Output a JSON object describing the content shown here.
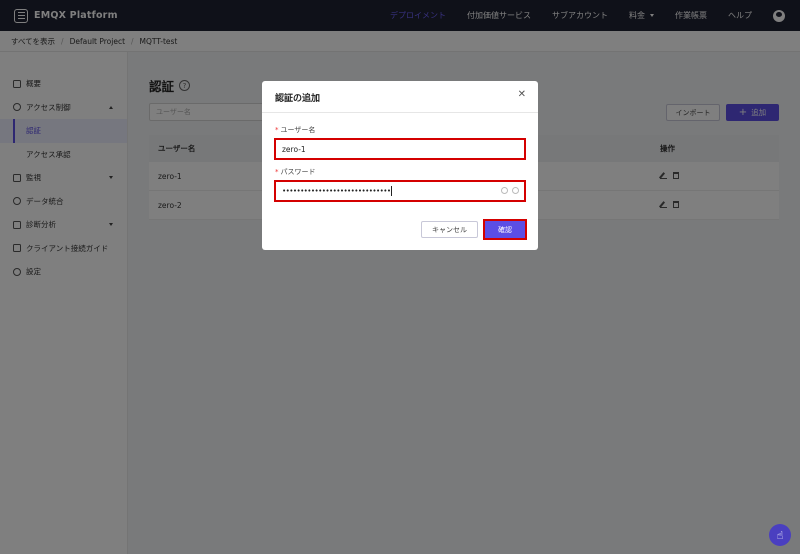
{
  "app": {
    "title": "EMQX Platform"
  },
  "topnav": {
    "items": [
      "デプロイメント",
      "付加価値サービス",
      "サブアカウント",
      "料金",
      "作業帳票",
      "ヘルプ"
    ]
  },
  "breadcrumb": [
    "すべてを表示",
    "Default Project",
    "MQTT-test"
  ],
  "sidebar": {
    "items": [
      {
        "label": "概要"
      },
      {
        "label": "アクセス制御"
      },
      {
        "label": "認証"
      },
      {
        "label": "アクセス承認"
      },
      {
        "label": "監視"
      },
      {
        "label": "データ統合"
      },
      {
        "label": "診断分析"
      },
      {
        "label": "クライアント接続ガイド"
      },
      {
        "label": "設定"
      }
    ]
  },
  "main": {
    "title": "認証",
    "search_placeholder": "ユーザー名",
    "import_label": "インポート",
    "add_label": "追加",
    "table": {
      "headers": [
        "ユーザー名",
        "操作"
      ],
      "rows": [
        {
          "username": "zero-1"
        },
        {
          "username": "zero-2"
        }
      ]
    }
  },
  "modal": {
    "title": "認証の追加",
    "username_label": "ユーザー名",
    "username_value": "zero-1",
    "password_label": "パスワード",
    "password_value": "••••••••••••••••••••••••••••••",
    "cancel_label": "キャンセル",
    "confirm_label": "確認"
  },
  "colors": {
    "accent": "#5c4ee5",
    "highlight": "#d40000",
    "topbar": "#1f2233"
  }
}
